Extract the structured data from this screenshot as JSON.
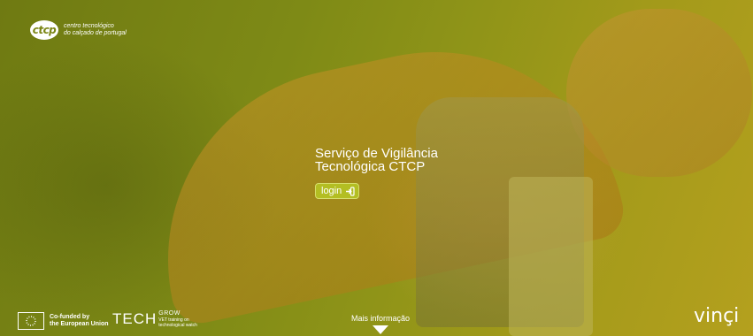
{
  "brand": {
    "logo_mark": "ctcp",
    "logo_line1": "centro tecnológico",
    "logo_line2": "do calçado de portugal"
  },
  "hero": {
    "title_line1": "Serviço de Vigilância",
    "title_line2": "Tecnológica CTCP",
    "login_label": "login",
    "login_icon": "sign-in-arrow-icon"
  },
  "footer": {
    "eu_line1": "Co-funded by",
    "eu_line2": "the European Union",
    "tech_word": "TECH",
    "tech_grow": "GROW",
    "tech_line1": "VET training on",
    "tech_line2": "technological watch",
    "more_info": "Mais informação",
    "more_icon": "triangle-down-icon",
    "partner": "vinçi"
  },
  "colors": {
    "overlay": "#8f9418",
    "button": "#b3be22",
    "text": "#ffffff"
  }
}
